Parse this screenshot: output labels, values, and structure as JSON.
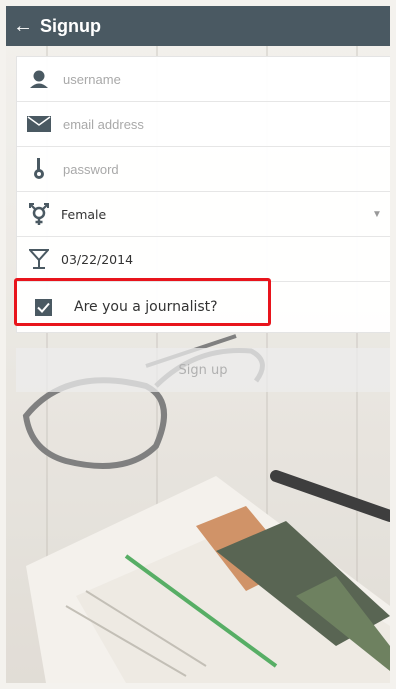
{
  "header": {
    "title": "Signup",
    "back_glyph": "←"
  },
  "form": {
    "username": {
      "placeholder": "username",
      "icon": "user-icon"
    },
    "email": {
      "placeholder": "email address",
      "icon": "envelope-icon"
    },
    "password": {
      "placeholder": "password",
      "icon": "key-icon"
    },
    "gender": {
      "value": "Female",
      "icon": "gender-icon",
      "caret": "▼"
    },
    "birthdate": {
      "value": "03/22/2014",
      "icon": "cocktail-glass-icon"
    },
    "journalist": {
      "label": "Are you a journalist?",
      "checked": true
    }
  },
  "signup_button": {
    "label": "Sign up"
  },
  "colors": {
    "header": "#4a5962",
    "highlight": "#e8141c"
  }
}
